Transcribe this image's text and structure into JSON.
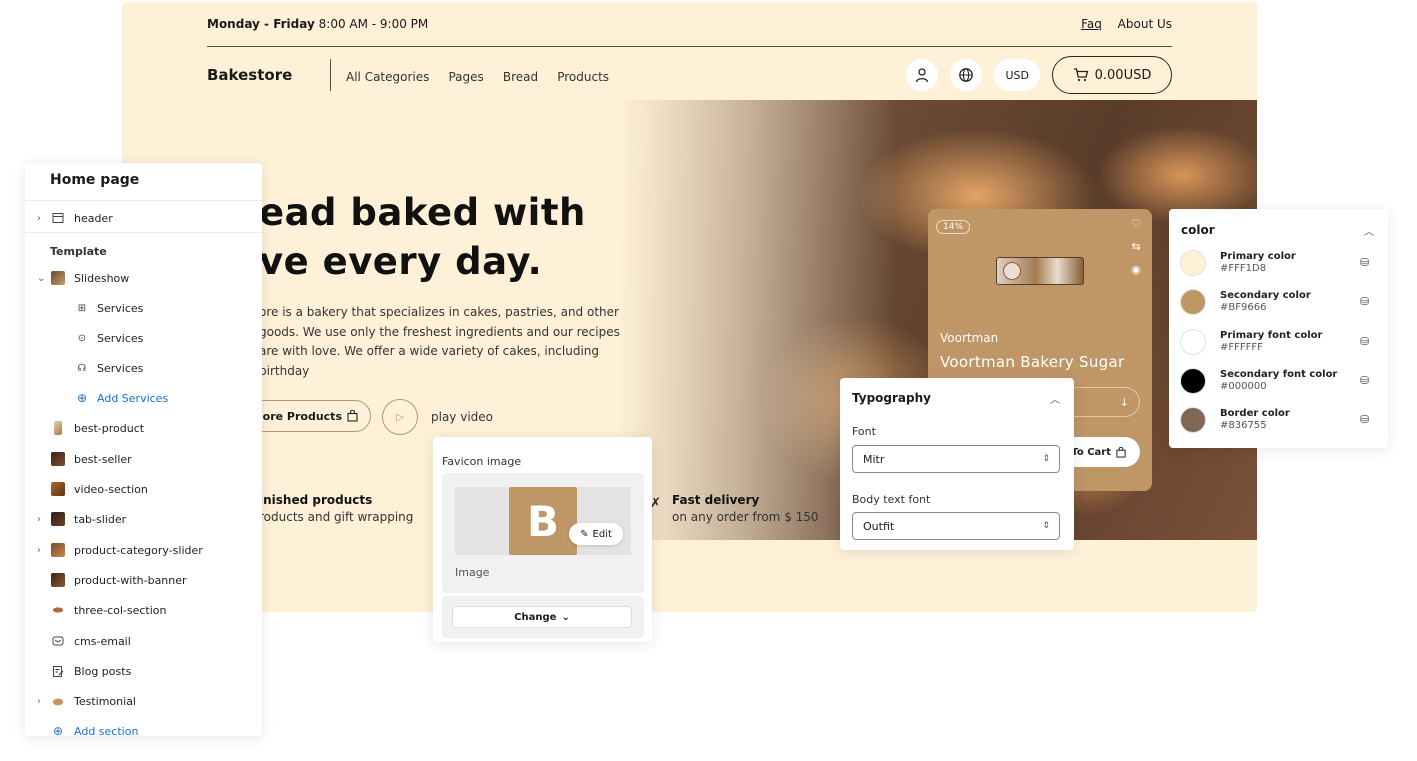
{
  "store": {
    "topbar": {
      "days": "Monday - Friday",
      "hours": "8:00 AM - 9:00 PM",
      "faq": "Faq",
      "about": "About Us"
    },
    "nav": {
      "brand": "Bakestore",
      "links": [
        "All Categories",
        "Pages",
        "Bread",
        "Products"
      ],
      "currency": "USD",
      "cart_total": "0.00USD"
    },
    "hero": {
      "title": "ead baked with\nve every day.",
      "description": "ore is a bakery that specializes in cakes, pastries, and other goods. We use only the freshest ingredients and our recipes are with love. We offer a wide variety of cakes, including birthday",
      "button_more": "t More Products",
      "play_label": "play video"
    },
    "features": [
      {
        "title": "inished products",
        "desc": "roducts and gift wrapping"
      },
      {
        "title": "Fast delivery",
        "desc": "on any order from $ 150"
      }
    ],
    "product_card": {
      "discount": "14%",
      "brand": "Voortman",
      "name": "Voortman Bakery Sugar",
      "add_to_cart": "To Cart"
    }
  },
  "sidebar": {
    "title": "Home page",
    "header_item": "header",
    "template_label": "Template",
    "slideshow": "Slideshow",
    "services": [
      "Services",
      "Services",
      "Services"
    ],
    "add_services": "Add Services",
    "sections": [
      "best-product",
      "best-seller",
      "video-section",
      "tab-slider",
      "product-category-slider",
      "product-with-banner",
      "three-col-section",
      "cms-email",
      "Blog posts",
      "Testimonial"
    ],
    "add_section": "Add section"
  },
  "favicon": {
    "title": "Favicon image",
    "letter": "B",
    "edit": "Edit",
    "caption": "Image",
    "change": "Change"
  },
  "typography": {
    "title": "Typography",
    "font_label": "Font",
    "font_value": "Mitr",
    "body_label": "Body text font",
    "body_value": "Outfit"
  },
  "color_panel": {
    "title": "color",
    "items": [
      {
        "name": "Primary color",
        "hex": "#FFF1D8"
      },
      {
        "name": "Secondary color",
        "hex": "#BF9666"
      },
      {
        "name": "Primary font color",
        "hex": "#FFFFFF"
      },
      {
        "name": "Secondary font color",
        "hex": "#000000"
      },
      {
        "name": "Border color",
        "hex": "#836755"
      }
    ]
  }
}
